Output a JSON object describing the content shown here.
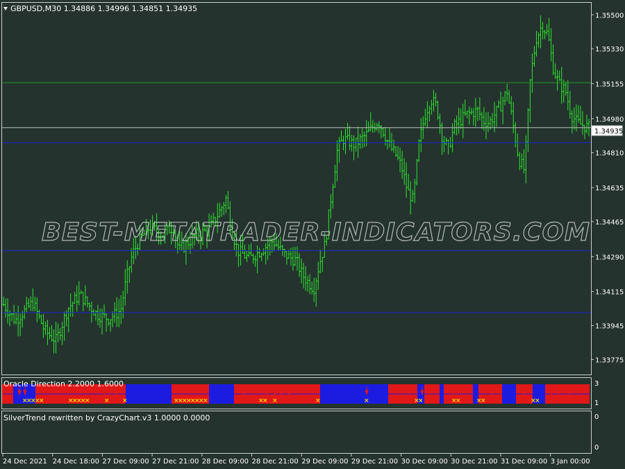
{
  "header": {
    "symbol_info": "GBPUSD,M30  1.34886 1.34996 1.34851 1.34935"
  },
  "price_axis": {
    "ticks": [
      "1.35500",
      "1.35330",
      "1.35155",
      "1.34980",
      "1.34810",
      "1.34635",
      "1.34465",
      "1.34290",
      "1.34115",
      "1.33945",
      "1.33775"
    ],
    "current_price": "1.34935"
  },
  "watermark": "BEST-METATRADER-INDICATORS.COM",
  "indicator1": {
    "title": "Oracle Direction 2.2000 1.6000",
    "axis_ticks": [
      "3",
      "1"
    ]
  },
  "indicator2": {
    "title": "SilverTrend rewritten by CrazyChart.v3 1.0000 0.0000",
    "axis_ticks": [
      "0",
      "0"
    ]
  },
  "time_axis": {
    "ticks": [
      "24 Dec 2021",
      "24 Dec 18:00",
      "27 Dec 09:00",
      "27 Dec 21:00",
      "28 Dec 09:00",
      "28 Dec 21:00",
      "29 Dec 09:00",
      "29 Dec 21:00",
      "30 Dec 09:00",
      "30 Dec 21:00",
      "31 Dec 09:00",
      "3 Jan 00:00"
    ]
  },
  "colors": {
    "background": "#25332f",
    "bars": "#2ee62e",
    "green_level": "#1f9a1f",
    "blue_level": "#1b27d8",
    "current_line": "#b8c0bd",
    "grid_border": "#c9cfcd",
    "oracle_blue": "#1c1ce0",
    "oracle_red": "#e01818",
    "oracle_yellow": "#f4e000"
  },
  "chart_data": {
    "type": "ohlc",
    "symbol": "GBPUSD",
    "timeframe": "M30",
    "ylim": [
      1.337,
      1.3556
    ],
    "close_path": [
      [
        0,
        1.3405
      ],
      [
        0.02,
        1.3397
      ],
      [
        0.05,
        1.3406
      ],
      [
        0.07,
        1.3392
      ],
      [
        0.09,
        1.3387
      ],
      [
        0.11,
        1.3403
      ],
      [
        0.13,
        1.341
      ],
      [
        0.16,
        1.34
      ],
      [
        0.18,
        1.3398
      ],
      [
        0.2,
        1.3402
      ],
      [
        0.21,
        1.3418
      ],
      [
        0.22,
        1.343
      ],
      [
        0.23,
        1.3436
      ],
      [
        0.25,
        1.3444
      ],
      [
        0.27,
        1.344
      ],
      [
        0.29,
        1.3444
      ],
      [
        0.3,
        1.3432
      ],
      [
        0.33,
        1.344
      ],
      [
        0.35,
        1.3442
      ],
      [
        0.37,
        1.3452
      ],
      [
        0.38,
        1.3458
      ],
      [
        0.39,
        1.3442
      ],
      [
        0.4,
        1.3432
      ],
      [
        0.42,
        1.3428
      ],
      [
        0.44,
        1.3432
      ],
      [
        0.46,
        1.3437
      ],
      [
        0.48,
        1.343
      ],
      [
        0.5,
        1.3427
      ],
      [
        0.51,
        1.342
      ],
      [
        0.53,
        1.3413
      ],
      [
        0.54,
        1.3426
      ],
      [
        0.55,
        1.3436
      ],
      [
        0.56,
        1.346
      ],
      [
        0.57,
        1.3482
      ],
      [
        0.58,
        1.3488
      ],
      [
        0.6,
        1.3485
      ],
      [
        0.62,
        1.349
      ],
      [
        0.64,
        1.3497
      ],
      [
        0.65,
        1.3491
      ],
      [
        0.66,
        1.3484
      ],
      [
        0.67,
        1.348
      ],
      [
        0.68,
        1.3474
      ],
      [
        0.69,
        1.3462
      ],
      [
        0.7,
        1.3457
      ],
      [
        0.71,
        1.3486
      ],
      [
        0.72,
        1.35
      ],
      [
        0.73,
        1.3508
      ],
      [
        0.74,
        1.3504
      ],
      [
        0.75,
        1.3488
      ],
      [
        0.76,
        1.3483
      ],
      [
        0.77,
        1.3494
      ],
      [
        0.79,
        1.35
      ],
      [
        0.81,
        1.3502
      ],
      [
        0.82,
        1.3497
      ],
      [
        0.83,
        1.3496
      ],
      [
        0.85,
        1.3505
      ],
      [
        0.86,
        1.3512
      ],
      [
        0.87,
        1.3496
      ],
      [
        0.88,
        1.3478
      ],
      [
        0.89,
        1.3472
      ],
      [
        0.9,
        1.3518
      ],
      [
        0.91,
        1.3538
      ],
      [
        0.92,
        1.3545
      ],
      [
        0.93,
        1.354
      ],
      [
        0.94,
        1.3522
      ],
      [
        0.95,
        1.3515
      ],
      [
        0.96,
        1.3512
      ],
      [
        0.97,
        1.35
      ],
      [
        0.98,
        1.3496
      ],
      [
        1,
        1.34935
      ]
    ],
    "horizontal_levels": [
      {
        "price": 1.3516,
        "color": "green"
      },
      {
        "price": 1.3486,
        "color": "blue"
      },
      {
        "price": 1.3432,
        "color": "blue"
      },
      {
        "price": 1.3401,
        "color": "blue"
      }
    ]
  }
}
